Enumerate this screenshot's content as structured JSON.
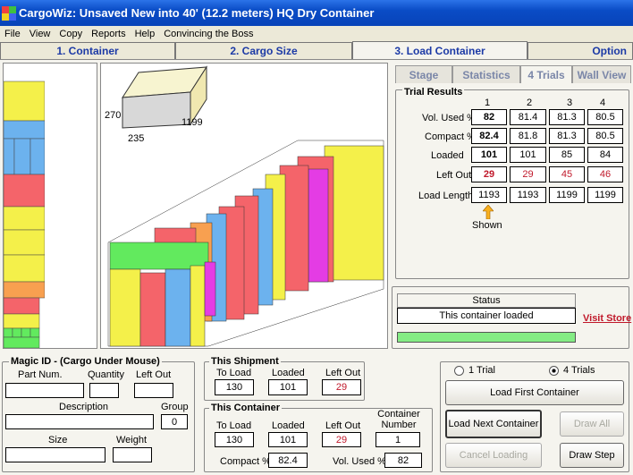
{
  "window": {
    "title": "CargoWiz:  Unsaved New into 40'  (12.2 meters)  HQ Dry Container"
  },
  "menu": [
    "File",
    "View",
    "Copy",
    "Reports",
    "Help",
    "Convincing the Boss"
  ],
  "main_tabs": [
    "1. Container",
    "2. Cargo Size",
    "3. Load Container",
    "Option"
  ],
  "cargo_box": {
    "height": "270",
    "width": "235",
    "length": "1199"
  },
  "sub_tabs": [
    "Stage",
    "Statistics",
    "4 Trials",
    "Wall View"
  ],
  "trials": {
    "title": "Trial Results",
    "columns": [
      "1",
      "2",
      "3",
      "4"
    ],
    "rows": [
      {
        "label": "Vol. Used %",
        "values": [
          "82",
          "81.4",
          "81.3",
          "80.5"
        ]
      },
      {
        "label": "Compact %",
        "values": [
          "82.4",
          "81.8",
          "81.3",
          "80.5"
        ]
      },
      {
        "label": "Loaded",
        "values": [
          "101",
          "101",
          "85",
          "84"
        ]
      },
      {
        "label": "Left Out",
        "values": [
          "29",
          "29",
          "45",
          "46"
        ]
      },
      {
        "label": "Load Length",
        "values": [
          "1193",
          "1193",
          "1199",
          "1199"
        ]
      }
    ],
    "shown_label": "Shown"
  },
  "status": {
    "title": "Status",
    "text": "This container loaded",
    "visit_store": "Visit Store"
  },
  "magic": {
    "title": "Magic ID - (Cargo Under Mouse)",
    "part_num": "Part Num.",
    "quantity": "Quantity",
    "left_out": "Left Out",
    "description": "Description",
    "group": "Group",
    "group_value": "0",
    "size": "Size",
    "weight": "Weight"
  },
  "shipment": {
    "title": "This Shipment",
    "to_load": "To Load",
    "loaded": "Loaded",
    "left_out": "Left Out",
    "to_load_value": "130",
    "loaded_value": "101",
    "left_out_value": "29"
  },
  "container": {
    "title": "This Container",
    "to_load": "To Load",
    "loaded": "Loaded",
    "left_out": "Left Out",
    "container_number": "Container Number",
    "to_load_value": "130",
    "loaded_value": "101",
    "left_out_value": "29",
    "number_value": "1",
    "compact": "Compact %",
    "compact_value": "82.4",
    "vol_used": "Vol. Used %",
    "vol_used_value": "82"
  },
  "controls": {
    "trial_1": "1 Trial",
    "trial_4": "4 Trials",
    "load_first": "Load First Container",
    "load_next": "Load Next Container",
    "draw_all": "Draw All",
    "cancel": "Cancel Loading",
    "draw_step": "Draw Step"
  },
  "colors": {
    "yellow": "#f4f04a",
    "red": "#f4646a",
    "blue": "#6cb2ee",
    "green": "#62ea5e",
    "magenta": "#e43ce4",
    "orange": "#f8a050"
  }
}
